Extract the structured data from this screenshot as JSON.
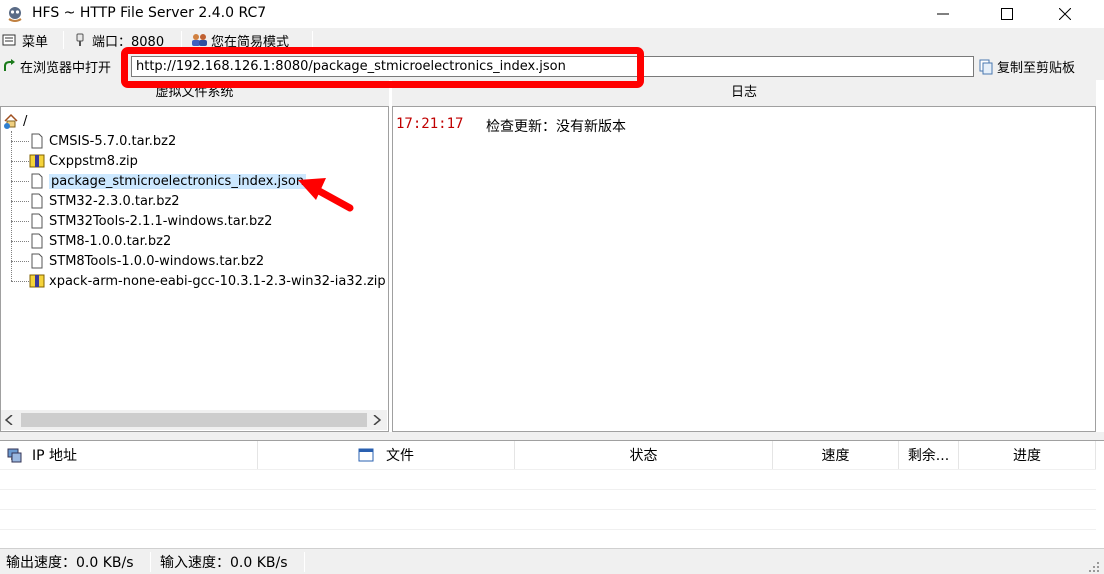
{
  "window": {
    "title": "HFS ~ HTTP File Server 2.4.0 RC7"
  },
  "toolbar": {
    "menu_label": "菜单",
    "port_label": "端口：8080",
    "mode_label": "您在简易模式"
  },
  "urlbar": {
    "open_in_browser_label": "在浏览器中打开",
    "url_value": "http://192.168.126.1:8080/package_stmicroelectronics_index.json",
    "copy_label": "复制至剪贴板"
  },
  "vfs": {
    "header": "虚拟文件系统",
    "root": "/",
    "items": [
      {
        "name": "CMSIS-5.7.0.tar.bz2",
        "icon": "file-icon"
      },
      {
        "name": "Cxppstm8.zip",
        "icon": "zip-icon"
      },
      {
        "name": "package_stmicroelectronics_index.json",
        "icon": "file-icon",
        "selected": true
      },
      {
        "name": "STM32-2.3.0.tar.bz2",
        "icon": "file-icon"
      },
      {
        "name": "STM32Tools-2.1.1-windows.tar.bz2",
        "icon": "file-icon"
      },
      {
        "name": "STM8-1.0.0.tar.bz2",
        "icon": "file-icon"
      },
      {
        "name": "STM8Tools-1.0.0-windows.tar.bz2",
        "icon": "file-icon"
      },
      {
        "name": "xpack-arm-none-eabi-gcc-10.3.1-2.3-win32-ia32.zip",
        "icon": "zip-icon"
      }
    ]
  },
  "log": {
    "header": "日志",
    "entries": [
      {
        "time": "17:21:17",
        "message": "检查更新：没有新版本"
      }
    ]
  },
  "connections": {
    "columns": [
      "IP 地址",
      "文件",
      "状态",
      "速度",
      "剩余...",
      "进度"
    ]
  },
  "statusbar": {
    "out_speed": "输出速度：0.0 KB/s",
    "in_speed": "输入速度：0.0 KB/s"
  },
  "colors": {
    "highlight": "#ff0000",
    "log_time": "#c00000",
    "selection": "#cce8ff"
  }
}
